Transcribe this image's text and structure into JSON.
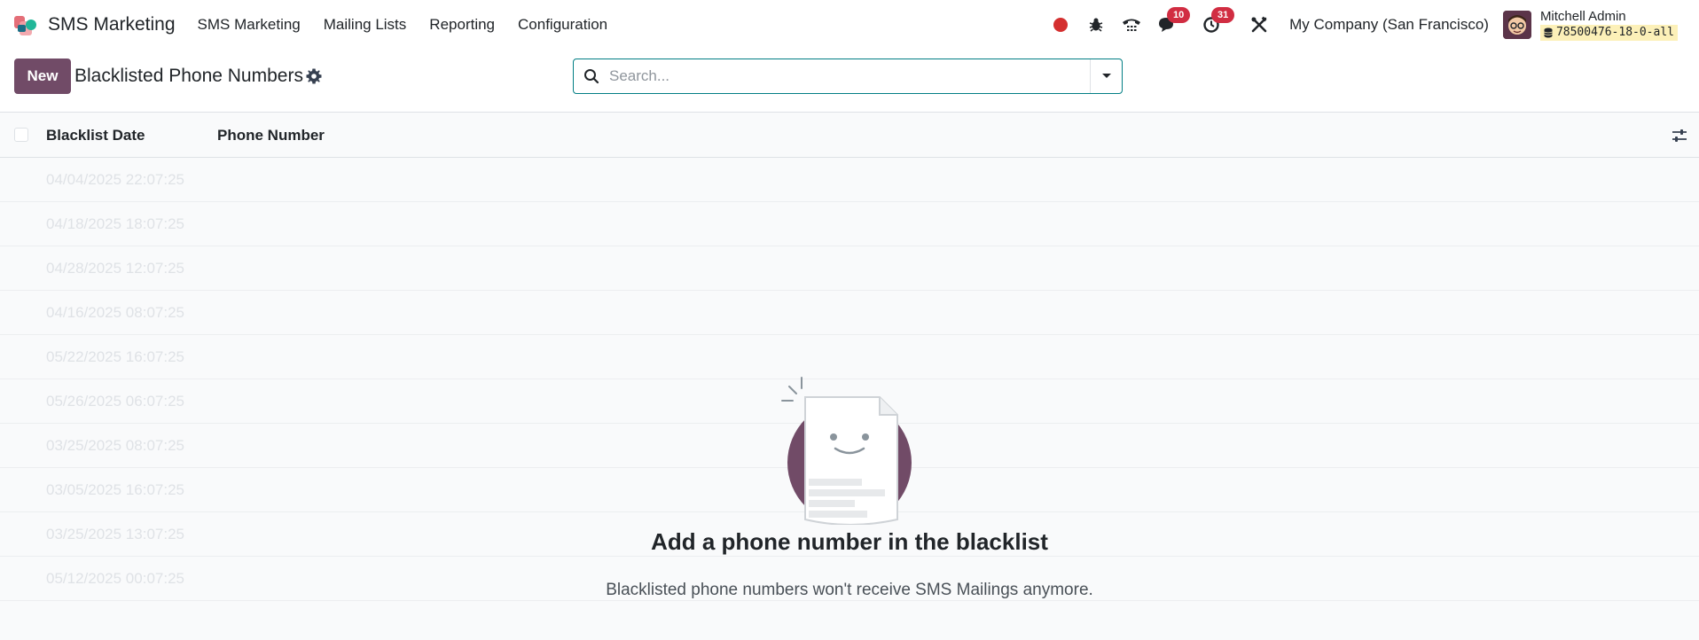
{
  "navbar": {
    "app_name": "SMS Marketing",
    "menu": [
      {
        "label": "SMS Marketing"
      },
      {
        "label": "Mailing Lists"
      },
      {
        "label": "Reporting"
      },
      {
        "label": "Configuration"
      }
    ],
    "messages_badge": "10",
    "activities_badge": "31",
    "company": "My Company (San Francisco)",
    "user_name": "Mitchell Admin",
    "db_name": "78500476-18-0-all"
  },
  "control_panel": {
    "new_label": "New",
    "title": "Blacklisted Phone Numbers",
    "search_placeholder": "Search..."
  },
  "list": {
    "columns": [
      "Blacklist Date",
      "Phone Number"
    ],
    "sample_dates": [
      "04/04/2025 22:07:25",
      "04/18/2025 18:07:25",
      "04/28/2025 12:07:25",
      "04/16/2025 08:07:25",
      "05/22/2025 16:07:25",
      "05/26/2025 06:07:25",
      "03/25/2025 08:07:25",
      "03/05/2025 16:07:25",
      "03/25/2025 13:07:25",
      "05/12/2025 00:07:25"
    ]
  },
  "empty_state": {
    "title": "Add a phone number in the blacklist",
    "subtitle": "Blacklisted phone numbers won't receive SMS Mailings anymore."
  },
  "colors": {
    "primary": "#714b67",
    "search_border": "#017e84",
    "badge": "#d12d42",
    "record": "#d42f2f"
  }
}
